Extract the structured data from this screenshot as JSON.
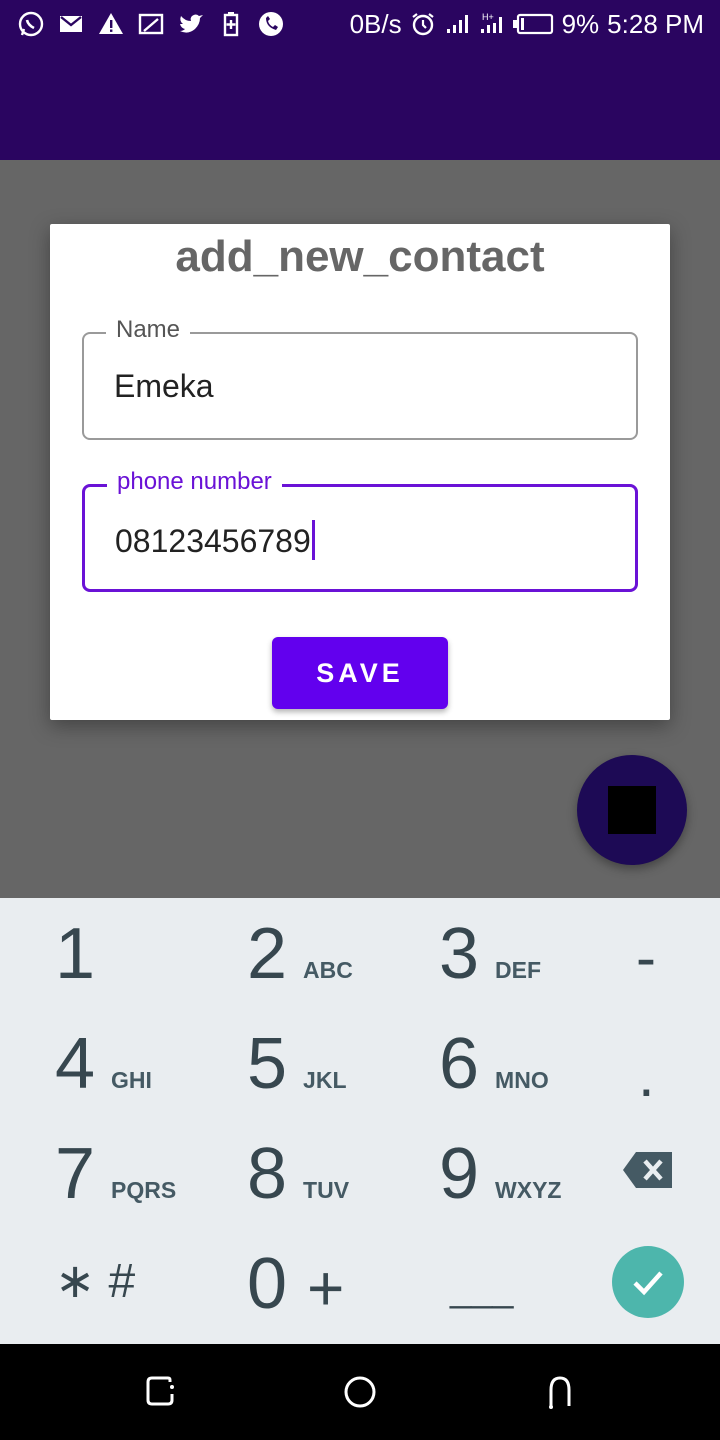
{
  "status_bar": {
    "speed": "0B/s",
    "battery_percent": "9%",
    "time": "5:28 PM",
    "network_label": "H+"
  },
  "dialog": {
    "title": "add_new_contact",
    "name_field": {
      "label": "Name",
      "value": "Emeka"
    },
    "phone_field": {
      "label": "phone number",
      "value": "08123456789"
    },
    "save_label": "SAVE"
  },
  "keypad": {
    "keys": [
      {
        "digit": "1",
        "letters": ""
      },
      {
        "digit": "2",
        "letters": "ABC"
      },
      {
        "digit": "3",
        "letters": "DEF"
      },
      {
        "digit": "4",
        "letters": "GHI"
      },
      {
        "digit": "5",
        "letters": "JKL"
      },
      {
        "digit": "6",
        "letters": "MNO"
      },
      {
        "digit": "7",
        "letters": "PQRS"
      },
      {
        "digit": "8",
        "letters": "TUV"
      },
      {
        "digit": "9",
        "letters": "WXYZ"
      },
      {
        "digit": "0",
        "letters": ""
      }
    ],
    "minus": "-",
    "period": ".",
    "star_hash": "∗ #",
    "plus": "+",
    "space": "___"
  },
  "colors": {
    "app_bar": "#2a0560",
    "accent": "#6200ee",
    "done_key": "#4db6ac"
  }
}
